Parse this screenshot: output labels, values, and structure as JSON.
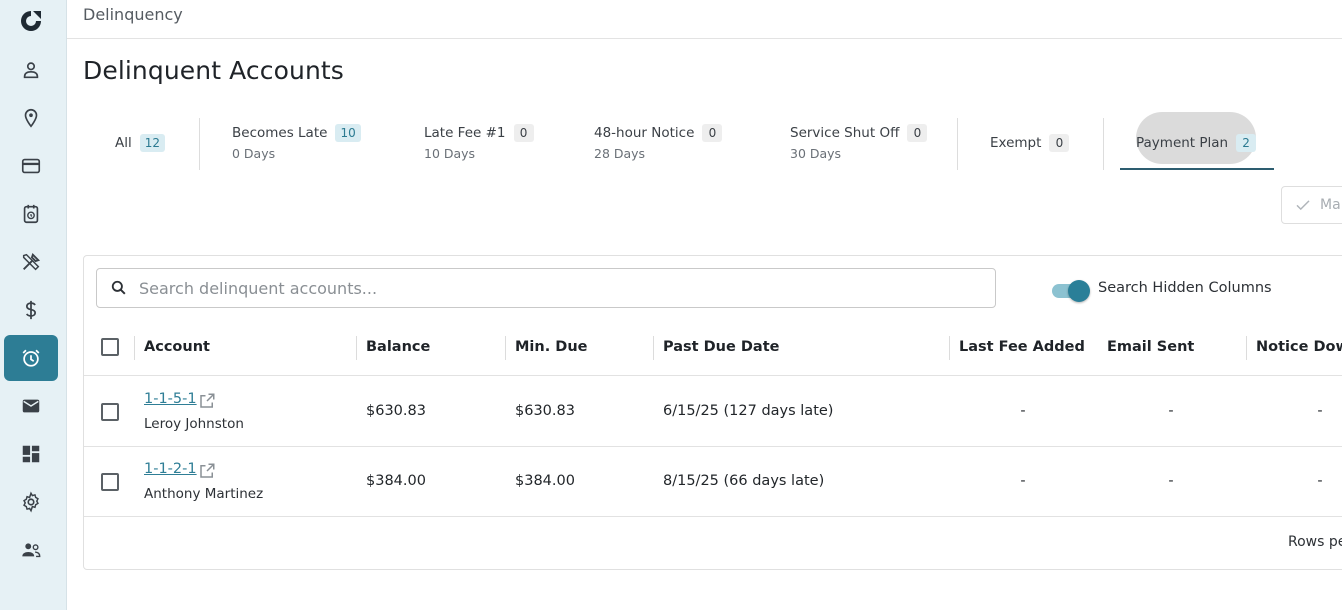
{
  "app": {
    "breadcrumb": "Delinquency",
    "page_title": "Delinquent Accounts"
  },
  "colors": {
    "accent": "#2d7d95",
    "sidebar_bg": "#e6f1f5",
    "link": "#2f7e96"
  },
  "sidebar": {
    "logo": "c-logo-icon",
    "items": [
      {
        "icon": "person-icon",
        "active": false
      },
      {
        "icon": "location-pin-icon",
        "active": false
      },
      {
        "icon": "credit-card-icon",
        "active": false
      },
      {
        "icon": "calendar-clock-icon",
        "active": false
      },
      {
        "icon": "tools-icon",
        "active": false
      },
      {
        "icon": "dollar-icon",
        "active": false
      },
      {
        "icon": "alarm-clock-icon",
        "active": true
      },
      {
        "icon": "mail-icon",
        "active": false
      },
      {
        "icon": "dashboard-icon",
        "active": false
      },
      {
        "icon": "gear-icon",
        "active": false
      },
      {
        "icon": "people-icon",
        "active": false
      }
    ]
  },
  "tabs": [
    {
      "label": "All",
      "count": "12",
      "sub": ""
    },
    {
      "label": "Becomes Late",
      "count": "10",
      "sub": "0 Days"
    },
    {
      "label": "Late Fee #1",
      "count": "0",
      "sub": "10 Days"
    },
    {
      "label": "48-hour Notice",
      "count": "0",
      "sub": "28 Days"
    },
    {
      "label": "Service Shut Off",
      "count": "0",
      "sub": "30 Days"
    },
    {
      "label": "Exempt",
      "count": "0",
      "sub": ""
    },
    {
      "label": "Payment Plan",
      "count": "2",
      "sub": "",
      "selected": true
    }
  ],
  "toolbar": {
    "mark_button_label": "Ma"
  },
  "search": {
    "placeholder": "Search delinquent accounts...",
    "value": "",
    "hidden_columns_label": "Search Hidden Columns",
    "hidden_columns_on": true
  },
  "table": {
    "columns": [
      "Account",
      "Balance",
      "Min. Due",
      "Past Due Date",
      "Last Fee Added",
      "Email Sent",
      "Notice Down"
    ],
    "rows": [
      {
        "account": "1-1-5-1",
        "name": "Leroy Johnston",
        "balance": "$630.83",
        "min_due": "$630.83",
        "past_due": "6/15/25 (127 days late)",
        "last_fee": "-",
        "email_sent": "-",
        "notice": "-"
      },
      {
        "account": "1-1-2-1",
        "name": "Anthony Martinez",
        "balance": "$384.00",
        "min_due": "$384.00",
        "past_due": "8/15/25 (66 days late)",
        "last_fee": "-",
        "email_sent": "-",
        "notice": "-"
      }
    ],
    "footer_rows_label": "Rows pe"
  }
}
